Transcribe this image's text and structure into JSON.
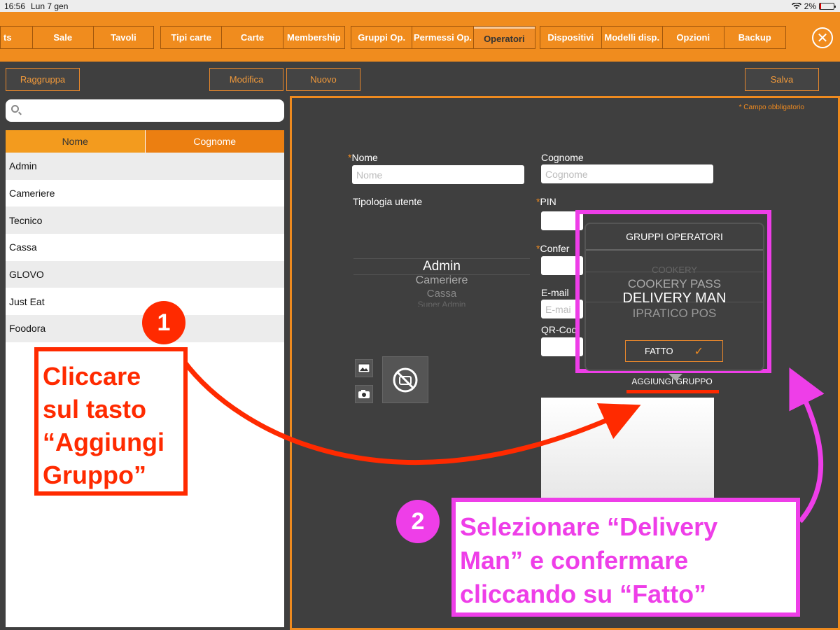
{
  "status": {
    "time": "16:56",
    "date": "Lun 7 gen",
    "battery": "2%"
  },
  "menu": {
    "group1": [
      "ts",
      "Sale",
      "Tavoli"
    ],
    "group2": [
      "Tipi carte",
      "Carte",
      "Membership"
    ],
    "group3": [
      "Gruppi Op.",
      "Permessi Op.",
      "Operatori"
    ],
    "group4": [
      "Dispositivi",
      "Modelli disp.",
      "Opzioni",
      "Backup"
    ],
    "active": "Operatori"
  },
  "toolbar": {
    "raggruppa": "Raggruppa",
    "modifica": "Modifica",
    "nuovo": "Nuovo",
    "salva": "Salva"
  },
  "list": {
    "headers": [
      "Nome",
      "Cognome"
    ],
    "rows": [
      "Admin",
      "Cameriere",
      "Tecnico",
      "Cassa",
      "GLOVO",
      "Just Eat",
      "Foodora"
    ]
  },
  "form": {
    "required_note": "* Campo obbligatorio",
    "nome_label": "Nome",
    "nome_placeholder": "Nome",
    "cognome_label": "Cognome",
    "cognome_placeholder": "Cognome",
    "tipologia_label": "Tipologia utente",
    "tipologia_options": [
      "Admin",
      "Cameriere",
      "Cassa",
      "Super Admin"
    ],
    "pin_label": "PIN",
    "conferma_label": "Confer",
    "email_label": "E-mail",
    "email_placeholder": "E-mai",
    "qr_label": "QR-Cod",
    "aggiungi_gruppo": "AGGIUNGI GRUPPO"
  },
  "popup": {
    "title": "GRUPPI OPERATORI",
    "options": [
      "COOKERY",
      "COOKERY PASS",
      "DELIVERY MAN",
      "IPRATICO POS"
    ],
    "selected": "DELIVERY MAN",
    "fatto": "FATTO",
    "check": "✓"
  },
  "annotations": {
    "step1_num": "1",
    "step1_lines": [
      "Cliccare",
      "sul tasto",
      "“Aggiungi",
      "Gruppo”"
    ],
    "step2_num": "2",
    "step2_lines": [
      "Selezionare “Delivery",
      "Man” e confermare",
      "cliccando su “Fatto”"
    ],
    "colors": {
      "red": "#ff2a00",
      "magenta": "#ee3ee8",
      "orange": "#f08c1e"
    }
  }
}
